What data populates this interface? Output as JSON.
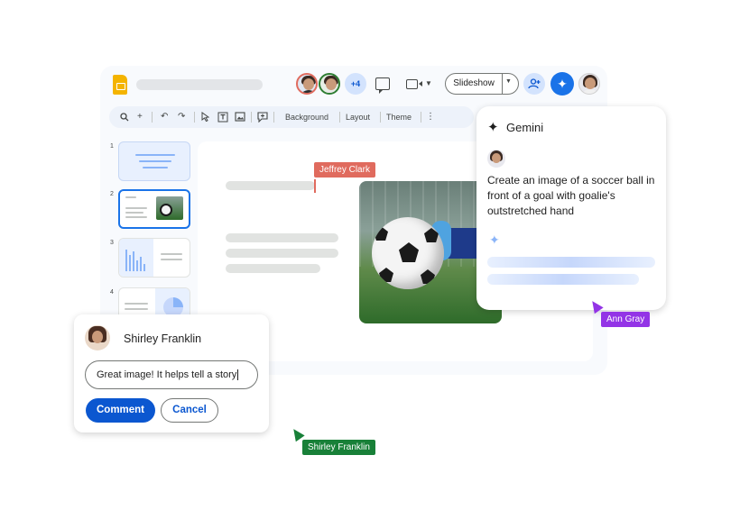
{
  "header": {
    "overflow_count": "+4",
    "slideshow_label": "Slideshow"
  },
  "toolbar": {
    "background_label": "Background",
    "layout_label": "Layout",
    "theme_label": "Theme"
  },
  "slides": {
    "numbers": [
      "1",
      "2",
      "3",
      "4"
    ]
  },
  "collaborators": {
    "jeffrey": "Jeffrey Clark",
    "ann": "Ann Gray",
    "shirley": "Shirley Franklin"
  },
  "gemini": {
    "title": "Gemini",
    "prompt": "Create an image of a soccer ball in front of a goal with goalie's outstretched hand"
  },
  "comment": {
    "author": "Shirley Franklin",
    "text": "Great image! It helps tell a story",
    "comment_label": "Comment",
    "cancel_label": "Cancel"
  },
  "colors": {
    "primary": "#0b57d0",
    "jeffrey_tag": "#e06b5e",
    "ann_tag": "#9334e6",
    "shirley_tag": "#188038",
    "slides_logo": "#f4b400"
  },
  "icons": [
    "slides-logo-icon",
    "chat-icon",
    "video-icon",
    "add-person-icon",
    "gemini-icon",
    "search-icon",
    "plus-icon",
    "undo-icon",
    "redo-icon",
    "select-icon",
    "textbox-icon",
    "image-icon",
    "comment-add-icon",
    "more-vert-icon",
    "sparkle-icon"
  ]
}
